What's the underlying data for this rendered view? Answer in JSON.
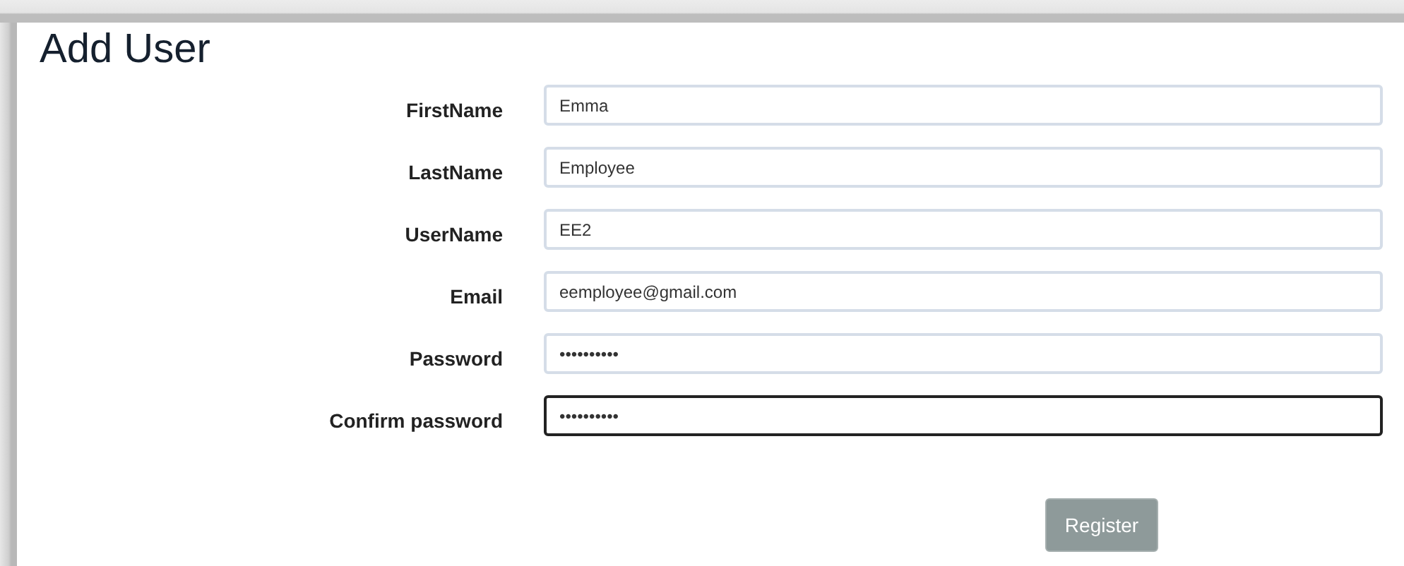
{
  "title": "Add User",
  "fields": [
    {
      "label": "FirstName",
      "value": "Emma",
      "focused": false
    },
    {
      "label": "LastName",
      "value": "Employee",
      "focused": false
    },
    {
      "label": "UserName",
      "value": "EE2",
      "focused": false
    },
    {
      "label": "Email",
      "value": "eemployee@gmail.com",
      "focused": false
    },
    {
      "label": "Password",
      "value": "••••••••••",
      "focused": false
    },
    {
      "label": "Confirm password",
      "value": "••••••••••",
      "focused": true
    }
  ],
  "register_button": "Register"
}
